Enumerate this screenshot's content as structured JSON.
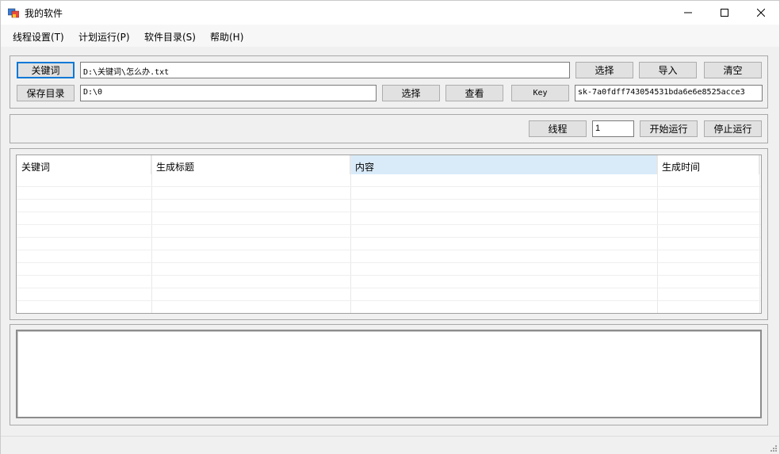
{
  "window": {
    "title": "我的软件"
  },
  "menu": [
    {
      "label": "线程设置(T)"
    },
    {
      "label": "计划运行(P)"
    },
    {
      "label": "软件目录(S)"
    },
    {
      "label": "帮助(H)"
    }
  ],
  "row1": {
    "keyword_button": "关键词",
    "keyword_path": "D:\\关键词\\怎么办.txt",
    "select_button": "选择",
    "import_button": "导入",
    "clear_button": "清空"
  },
  "row2": {
    "save_dir_button": "保存目录",
    "save_dir_path": "D:\\0",
    "select_button": "选择",
    "view_button": "查看",
    "key_button": "Key",
    "key_value": "sk-7a0fdff743054531bda6e6e8525acce3"
  },
  "controls": {
    "thread_button": "线程",
    "thread_count": "1",
    "start_button": "开始运行",
    "stop_button": "停止运行"
  },
  "grid": {
    "columns": [
      "关键词",
      "生成标题",
      "内容",
      "生成时间"
    ],
    "rows": []
  },
  "log": {
    "text": ""
  }
}
